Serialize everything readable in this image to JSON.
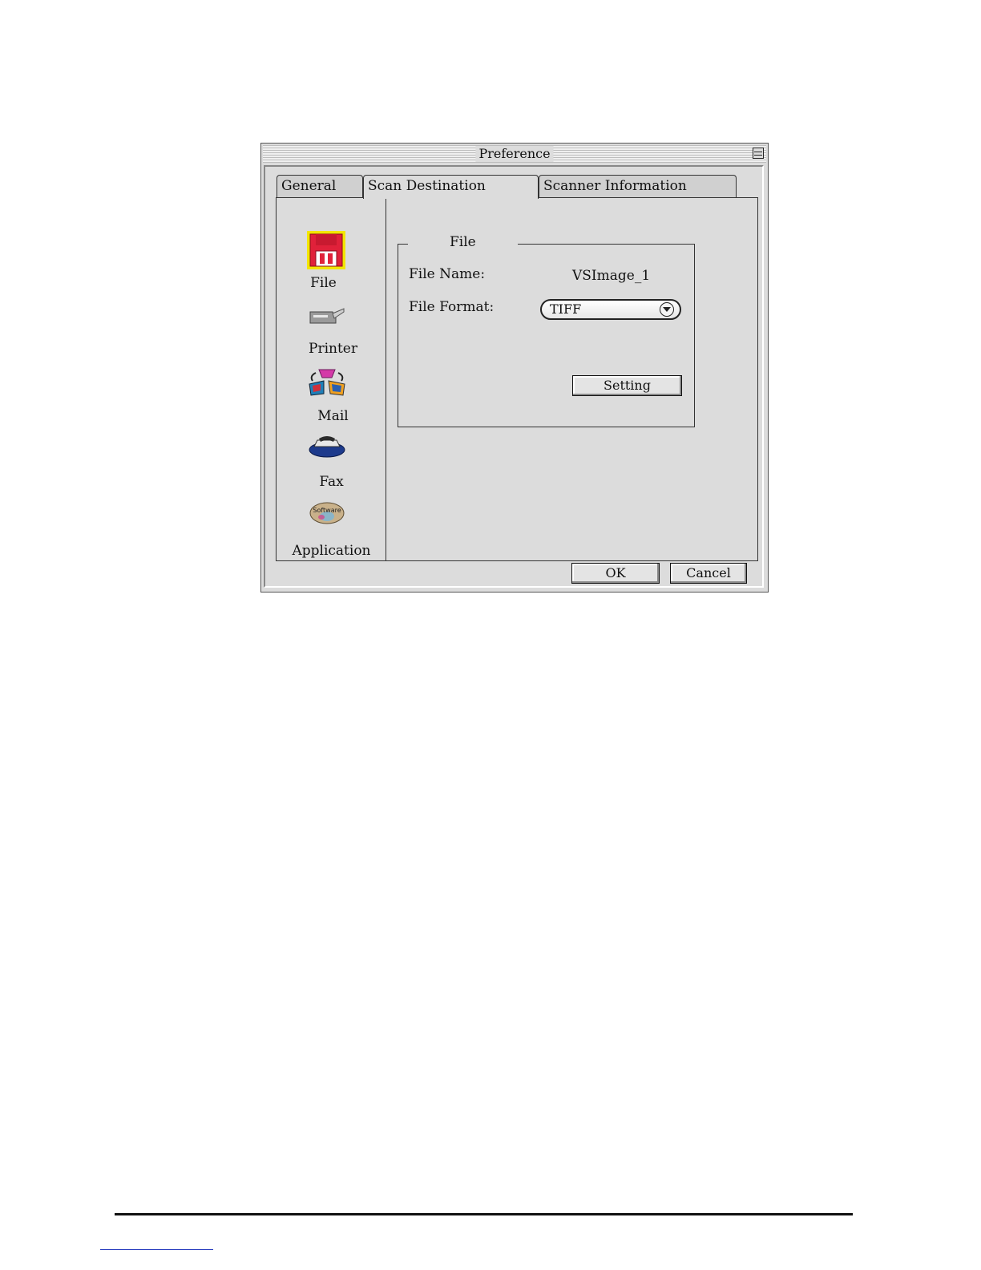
{
  "window": {
    "title": "Preference"
  },
  "tabs": [
    {
      "label": "General",
      "active": false
    },
    {
      "label": "Scan Destination",
      "active": true
    },
    {
      "label": "Scanner Information",
      "active": false
    }
  ],
  "sidebar": {
    "items": [
      {
        "label": "File",
        "icon": "floppy-disk-icon",
        "selected": true
      },
      {
        "label": "Printer",
        "icon": "printer-icon",
        "selected": false
      },
      {
        "label": "Mail",
        "icon": "mail-icon",
        "selected": false
      },
      {
        "label": "Fax",
        "icon": "fax-icon",
        "selected": false
      },
      {
        "label": "Application",
        "icon": "software-cd-icon",
        "selected": false
      },
      {
        "icon_text": "Software"
      }
    ]
  },
  "file_group": {
    "title": "File",
    "file_name_label": "File Name:",
    "file_name_value": "VSImage_1",
    "file_format_label": "File Format:",
    "file_format_value": "TIFF",
    "setting_label": "Setting"
  },
  "buttons": {
    "ok": "OK",
    "cancel": "Cancel"
  },
  "colors": {
    "selection_yellow": "#f2e600",
    "floppy_red": "#e0213a",
    "window_gray": "#dcdcdc"
  }
}
